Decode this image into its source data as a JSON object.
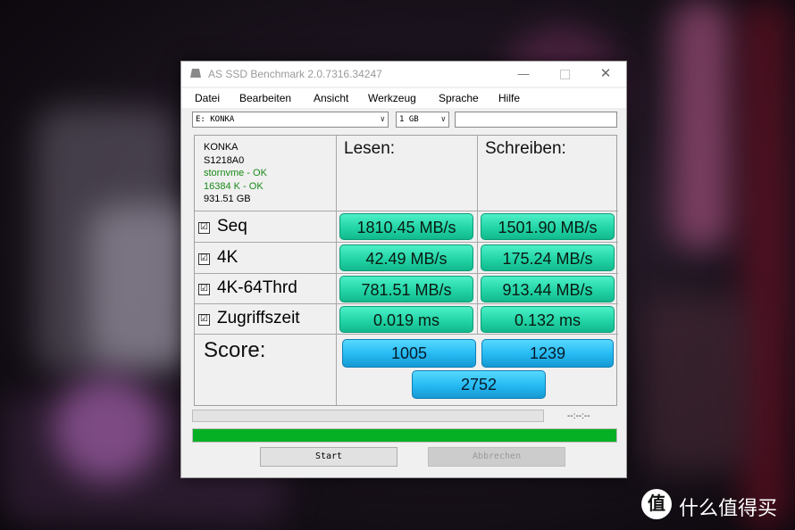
{
  "window": {
    "title": "AS SSD Benchmark 2.0.7316.34247",
    "minimize_symbol": "—",
    "close_symbol": "✕"
  },
  "menu": [
    "Datei",
    "Bearbeiten",
    "Ansicht",
    "Werkzeug",
    "Sprache",
    "Hilfe"
  ],
  "drive_select": {
    "value": "E: KONKA",
    "arrow": "∨"
  },
  "size_select": {
    "value": "1 GB",
    "arrow": "∨"
  },
  "drive_info": {
    "name": "KONKA",
    "firmware": "S1218A0",
    "driver_status": "stornvme - OK",
    "alignment_status": "16384 K - OK",
    "capacity": "931.51 GB"
  },
  "columns": {
    "read": "Lesen:",
    "write": "Schreiben:"
  },
  "tests": [
    {
      "label": "Seq",
      "checked": "☑",
      "read": "1810.45 MB/s",
      "write": "1501.90 MB/s"
    },
    {
      "label": "4K",
      "checked": "☑",
      "read": "42.49 MB/s",
      "write": "175.24 MB/s"
    },
    {
      "label": "4K-64Thrd",
      "checked": "☑",
      "read": "781.51 MB/s",
      "write": "913.44 MB/s"
    },
    {
      "label": "Zugriffszeit",
      "checked": "☑",
      "read": "0.019 ms",
      "write": "0.132 ms"
    }
  ],
  "score": {
    "label": "Score:",
    "read": "1005",
    "write": "1239",
    "total": "2752"
  },
  "progress": {
    "time": "--:--:--",
    "main_fraction": 1.0,
    "fill_color": "#06b025"
  },
  "buttons": {
    "start": "Start",
    "abort": "Abbrechen"
  },
  "watermark": {
    "logo": "值",
    "text": "什么值得买"
  }
}
